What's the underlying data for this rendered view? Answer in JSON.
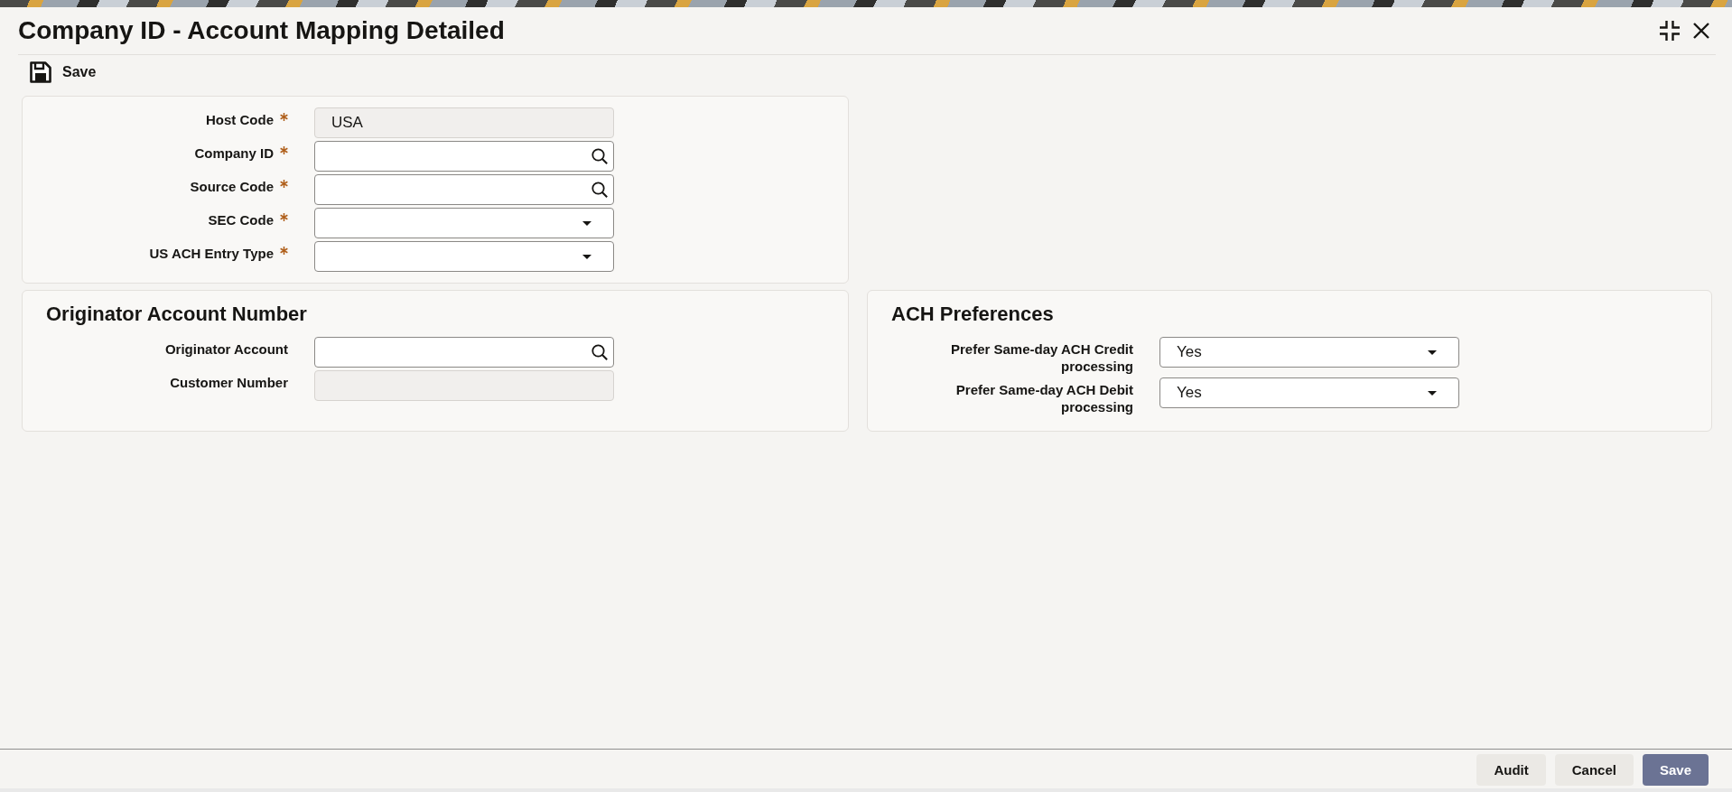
{
  "window": {
    "title": "Company ID - Account Mapping Detailed"
  },
  "toolbar": {
    "buttons": [
      {
        "label": "Save"
      }
    ]
  },
  "main_section": {
    "fields": [
      {
        "label": "Host Code",
        "required": true,
        "kind": "text",
        "disabled": true,
        "value": "USA"
      },
      {
        "label": "Company ID",
        "required": true,
        "kind": "lookup",
        "disabled": false
      },
      {
        "label": "Source Code",
        "required": true,
        "kind": "lookup",
        "disabled": false
      },
      {
        "label": "SEC Code",
        "required": true,
        "kind": "select",
        "disabled": false
      },
      {
        "label": "US ACH Entry Type",
        "required": true,
        "kind": "select",
        "disabled": false
      }
    ]
  },
  "sections": [
    {
      "title": "Originator Account Number",
      "fields": [
        {
          "label": "Originator Account",
          "required": false,
          "kind": "lookup",
          "disabled": false
        },
        {
          "label": "Customer Number",
          "required": false,
          "kind": "text",
          "disabled": true
        }
      ]
    },
    {
      "title": "ACH Preferences",
      "fields": [
        {
          "label": "Prefer Same-day ACH Credit processing",
          "required": false,
          "kind": "select",
          "disabled": false,
          "value": "Yes"
        },
        {
          "label": "Prefer Same-day ACH Debit processing",
          "required": false,
          "kind": "select",
          "disabled": false,
          "value": "Yes"
        }
      ]
    }
  ],
  "footer": {
    "buttons": [
      {
        "label": "Audit",
        "kind": "secondary"
      },
      {
        "label": "Cancel",
        "kind": "secondary"
      },
      {
        "label": "Save",
        "kind": "primary"
      }
    ]
  }
}
